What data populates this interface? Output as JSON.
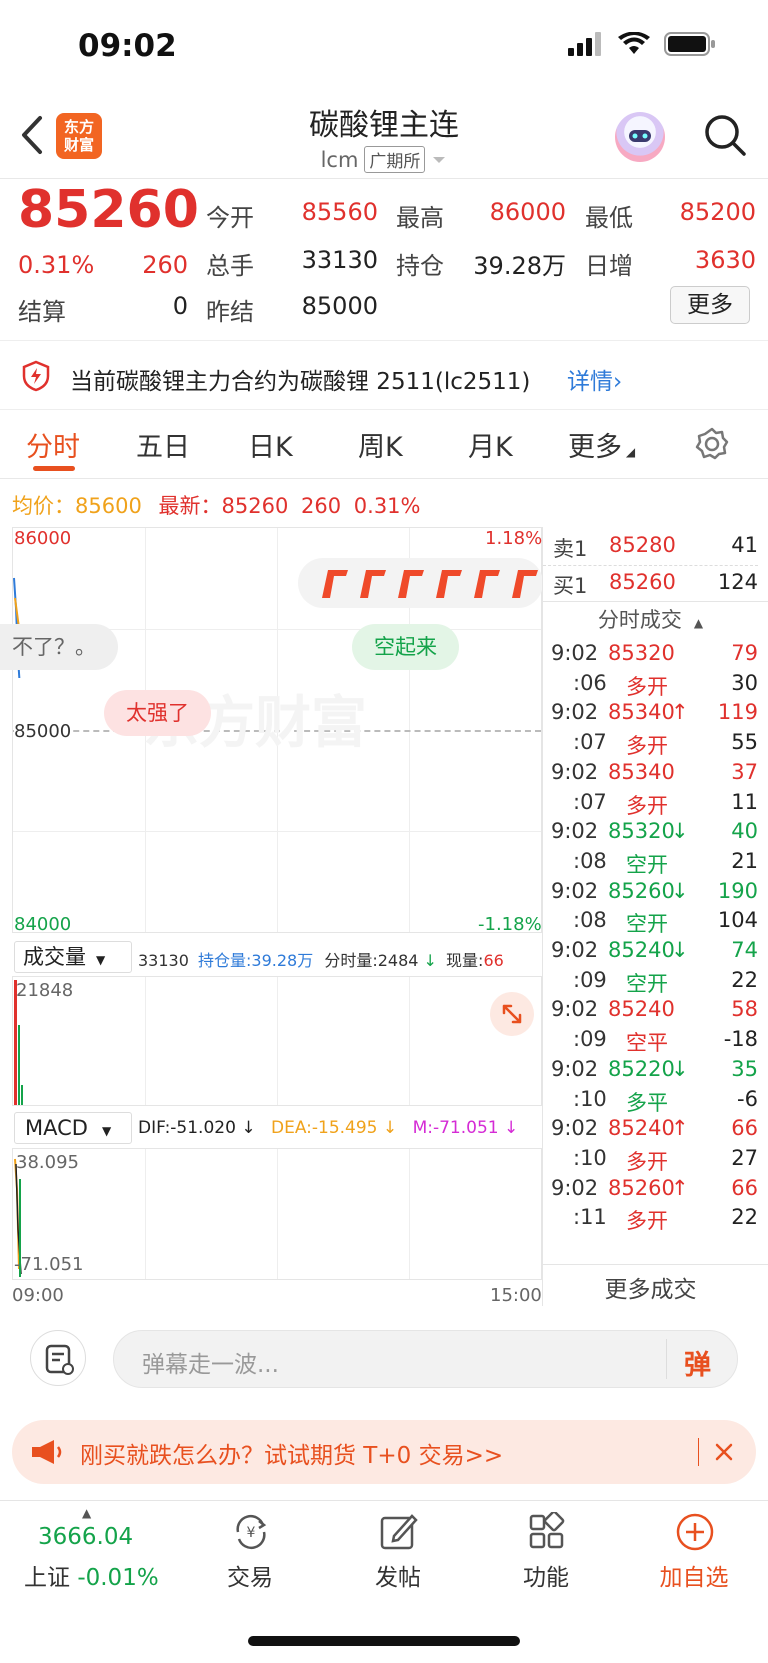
{
  "status_bar": {
    "time": "09:02"
  },
  "header": {
    "logo_line1": "东方",
    "logo_line2": "财富",
    "title": "碳酸锂主连",
    "code": "lcm",
    "exchange": "广期所"
  },
  "quote": {
    "price": "85260",
    "change_pct": "0.31%",
    "change": "260",
    "settle_label": "结算",
    "settle": "0",
    "open_label": "今开",
    "open": "85560",
    "high_label": "最高",
    "high": "86000",
    "low_label": "最低",
    "low": "85200",
    "volume_label": "总手",
    "volume": "33130",
    "oi_label": "持仓",
    "oi": "39.28万",
    "daily_inc_label": "日增",
    "daily_inc": "3630",
    "prev_settle_label": "昨结",
    "prev_settle": "85000",
    "more": "更多"
  },
  "notice": {
    "text": "当前碳酸锂主力合约为碳酸锂 2511(lc2511)",
    "link": "详情"
  },
  "tabs": [
    "分时",
    "五日",
    "日K",
    "周K",
    "月K",
    "更多"
  ],
  "info": {
    "avg_label": "均价：",
    "avg": "85600",
    "latest_label": "最新：",
    "latest": "85260",
    "chg": "260",
    "pct": "0.31%"
  },
  "chart": {
    "y_top": "86000",
    "y_mid": "85000",
    "y_bot": "84000",
    "pct_top": "1.18%",
    "pct_bot": "-1.18%",
    "danmaku": [
      "不了？。",
      "空起来",
      "太强了"
    ],
    "watermark": "东方财富",
    "vol_dropdown": "成交量",
    "vol_total": "33130",
    "oi_label": "持仓量:",
    "oi": "39.28万",
    "tick_vol_label": "分时量:",
    "tick_vol": "2484",
    "cur_vol_label": "现量:",
    "cur_vol": "66",
    "vol_max": "21848",
    "macd_dropdown": "MACD",
    "dif": "DIF:-51.020",
    "dea": "DEA:-15.495",
    "m": "M:-71.051",
    "macd_top": "38.095",
    "macd_bot": "-71.051",
    "time_start": "09:00",
    "time_end": "15:00"
  },
  "order_book": {
    "sell": {
      "label": "卖1",
      "price": "85280",
      "vol": "41"
    },
    "buy": {
      "label": "买1",
      "price": "85260",
      "vol": "124"
    },
    "trades_title": "分时成交",
    "trades": [
      {
        "t": "9:02",
        "p": "85320",
        "v": "79",
        "arrow": "",
        "color": "red"
      },
      {
        "t": ":06",
        "p": "多开",
        "v": "30",
        "arrow": "",
        "color": "red"
      },
      {
        "t": "9:02",
        "p": "85340",
        "v": "119",
        "arrow": "↑",
        "color": "red"
      },
      {
        "t": ":07",
        "p": "多开",
        "v": "55",
        "arrow": "",
        "color": "red"
      },
      {
        "t": "9:02",
        "p": "85340",
        "v": "37",
        "arrow": "",
        "color": "red"
      },
      {
        "t": ":07",
        "p": "多开",
        "v": "11",
        "arrow": "",
        "color": "red"
      },
      {
        "t": "9:02",
        "p": "85320",
        "v": "40",
        "arrow": "↓",
        "color": "green"
      },
      {
        "t": ":08",
        "p": "空开",
        "v": "21",
        "arrow": "",
        "color": "green"
      },
      {
        "t": "9:02",
        "p": "85260",
        "v": "190",
        "arrow": "↓",
        "color": "green"
      },
      {
        "t": ":08",
        "p": "空开",
        "v": "104",
        "arrow": "",
        "color": "green"
      },
      {
        "t": "9:02",
        "p": "85240",
        "v": "74",
        "arrow": "↓",
        "color": "green"
      },
      {
        "t": ":09",
        "p": "空开",
        "v": "22",
        "arrow": "",
        "color": "green"
      },
      {
        "t": "9:02",
        "p": "85240",
        "v": "58",
        "arrow": "",
        "color": "red"
      },
      {
        "t": ":09",
        "p": "空平",
        "v": "-18",
        "arrow": "",
        "color": "red"
      },
      {
        "t": "9:02",
        "p": "85220",
        "v": "35",
        "arrow": "↓",
        "color": "green"
      },
      {
        "t": ":10",
        "p": "多平",
        "v": "-6",
        "arrow": "",
        "color": "green"
      },
      {
        "t": "9:02",
        "p": "85240",
        "v": "66",
        "arrow": "↑",
        "color": "red"
      },
      {
        "t": ":10",
        "p": "多开",
        "v": "27",
        "arrow": "",
        "color": "red"
      },
      {
        "t": "9:02",
        "p": "85260",
        "v": "66",
        "arrow": "↑",
        "color": "red"
      },
      {
        "t": ":11",
        "p": "多开",
        "v": "22",
        "arrow": "",
        "color": "red"
      }
    ],
    "more_trades": "更多成交"
  },
  "comment": {
    "placeholder": "弹幕走一波...",
    "danmaku_btn": "弹"
  },
  "banner": {
    "text": "刚买就跌怎么办？试试期货 T+0 交易>>"
  },
  "bottom_nav": {
    "index_value": "3666.04",
    "index_name": "上证",
    "index_pct": "-0.01%",
    "items": [
      "交易",
      "发帖",
      "功能",
      "加自选"
    ]
  },
  "colors": {
    "red": "#e0312d",
    "green": "#14a34a",
    "orange": "#e8501f",
    "blue": "#2f7bd9",
    "gold": "#f0a21b",
    "magenta": "#d52bd5"
  }
}
